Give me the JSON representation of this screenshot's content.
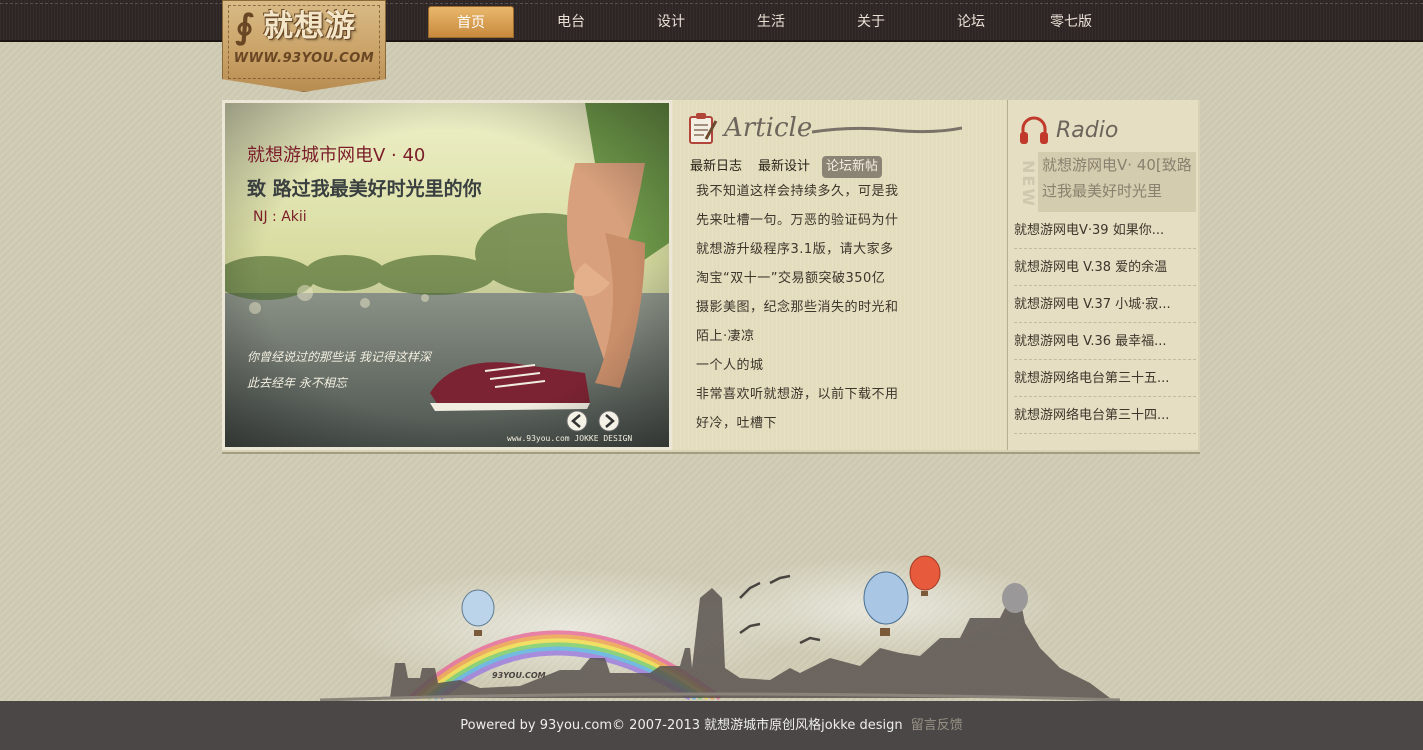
{
  "logo": {
    "title": "就想游",
    "url": "WWW.93YOU.COM"
  },
  "nav": {
    "items": [
      {
        "label": "首页",
        "active": true
      },
      {
        "label": "电台"
      },
      {
        "label": "设计"
      },
      {
        "label": "生活"
      },
      {
        "label": "关于"
      },
      {
        "label": "论坛"
      },
      {
        "label": "零七版"
      }
    ]
  },
  "slider": {
    "title": "就想游城市网电V · 40",
    "subtitle": "致 路过我最美好时光里的你",
    "nj": "NJ : Akii",
    "poem_line1": "你曾经说过的那些话 我记得这样深",
    "poem_line2": "此去经年 永不相忘",
    "watermark": "www.93you.com   JOKKE DESIGN"
  },
  "article": {
    "heading": "Article",
    "tabs": [
      "最新日志",
      "最新设计",
      "论坛新帖"
    ],
    "active_tab": 2,
    "items": [
      "我不知道这样会持续多久，可是我",
      "先来吐槽一句。万恶的验证码为什",
      "就想游升级程序3.1版，请大家多",
      "淘宝“双十一”交易额突破350亿",
      "摄影美图，纪念那些消失的时光和",
      "陌上·凄凉",
      "一个人的城",
      "非常喜欢听就想游，以前下载不用",
      "好冷，吐槽下"
    ]
  },
  "radio": {
    "heading": "Radio",
    "new_tag": "NEW",
    "featured": "就想游网电V· 40[致路过我最美好时光里",
    "items": [
      "就想游网电V·39 如果你...",
      "就想游网电 V.38 爱的余温",
      "就想游网电 V.37 小城·寂...",
      "就想游网电 V.36 最幸福...",
      "就想游网络电台第三十五...",
      "就想游网络电台第三十四..."
    ]
  },
  "footer_art": {
    "label": "93YOU.COM"
  },
  "footer": {
    "text": "Powered by 93you.com© 2007-2013 就想游城市原创风格jokke design",
    "feedback": "留言反馈"
  },
  "colors": {
    "background": "#d0ccb5",
    "nav_bg": "#2e2624",
    "nav_active": "#c88a3d",
    "footer_bg": "#4a4746"
  }
}
